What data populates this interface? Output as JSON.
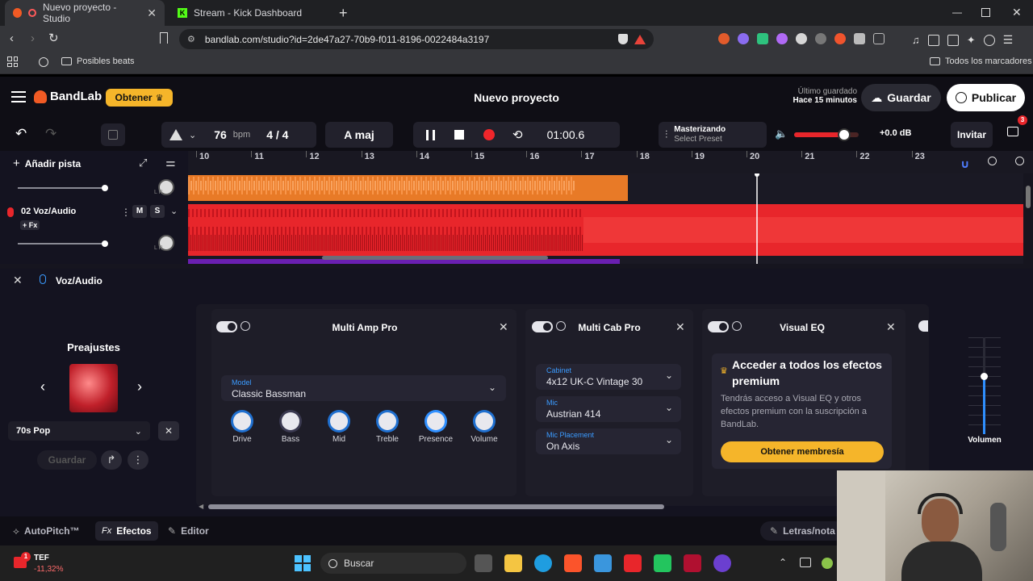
{
  "browser": {
    "tabs": [
      {
        "title": "Nuevo proyecto - Studio",
        "active": true
      },
      {
        "title": "Stream - Kick Dashboard",
        "active": false
      }
    ],
    "new_tab": "+",
    "url": "bandlab.com/studio?id=2de47a27-70b9-f011-8196-0022484a3197",
    "bookmark_folder": "Posibles beats",
    "all_bookmarks": "Todos los marcadores"
  },
  "app": {
    "brand": "BandLab",
    "get_label": "Obtener",
    "project_title": "Nuevo proyecto",
    "last_saved_label": "Último guardado",
    "last_saved_time": "Hace 15 minutos",
    "save_label": "Guardar",
    "publish_label": "Publicar",
    "invite_label": "Invitar",
    "gift_badge": "3",
    "accent": "#f15a24"
  },
  "toolbar": {
    "bpm_value": "76",
    "bpm_unit": "bpm",
    "time_signature": "4 / 4",
    "key": "A maj",
    "time": "01:00.6",
    "mastering_title": "Masterizando",
    "mastering_sub": "Select Preset",
    "master_volume": 0.78,
    "db": "+0.0 dB"
  },
  "tracks": {
    "add_track": "Añadir pista",
    "timeline_ticks": [
      "10",
      "11",
      "12",
      "13",
      "14",
      "15",
      "16",
      "17",
      "18",
      "19",
      "20",
      "21",
      "22",
      "23"
    ],
    "track2_name": "02  Voz/Audio",
    "mute": "M",
    "solo": "S",
    "fx": "+ Fx",
    "lr": "L    R"
  },
  "fx": {
    "track_name": "Voz/Audio",
    "presets_title": "Preajustes",
    "preset_name": "70s Pop",
    "save_preset": "Guardar",
    "amp": {
      "title": "Multi Amp Pro",
      "model_label": "Model",
      "model_value": "Classic Bassman",
      "knobs": [
        "Drive",
        "Bass",
        "Mid",
        "Treble",
        "Presence",
        "Volume"
      ]
    },
    "cab": {
      "title": "Multi Cab Pro",
      "cabinet_label": "Cabinet",
      "cabinet_value": "4x12 UK-C Vintage 30",
      "mic_label": "Mic",
      "mic_value": "Austrian 414",
      "placement_label": "Mic Placement",
      "placement_value": "On Axis"
    },
    "eq": {
      "title": "Visual EQ",
      "promo_title": "Acceder a todos los efectos premium",
      "promo_body": "Tendrás acceso a Visual EQ y otros efectos premium con la suscripción a BandLab.",
      "promo_button": "Obtener membresía"
    },
    "volume_label": "Volumen",
    "volume_level": 0.6
  },
  "bottom_tabs": {
    "autopitch": "AutoPitch™",
    "effects": "Efectos",
    "editor": "Editor",
    "lyrics": "Letras/nota"
  },
  "taskbar": {
    "stock_name": "TEF",
    "stock_change": "-11,32%",
    "stock_badge": "1",
    "search": "Buscar"
  }
}
